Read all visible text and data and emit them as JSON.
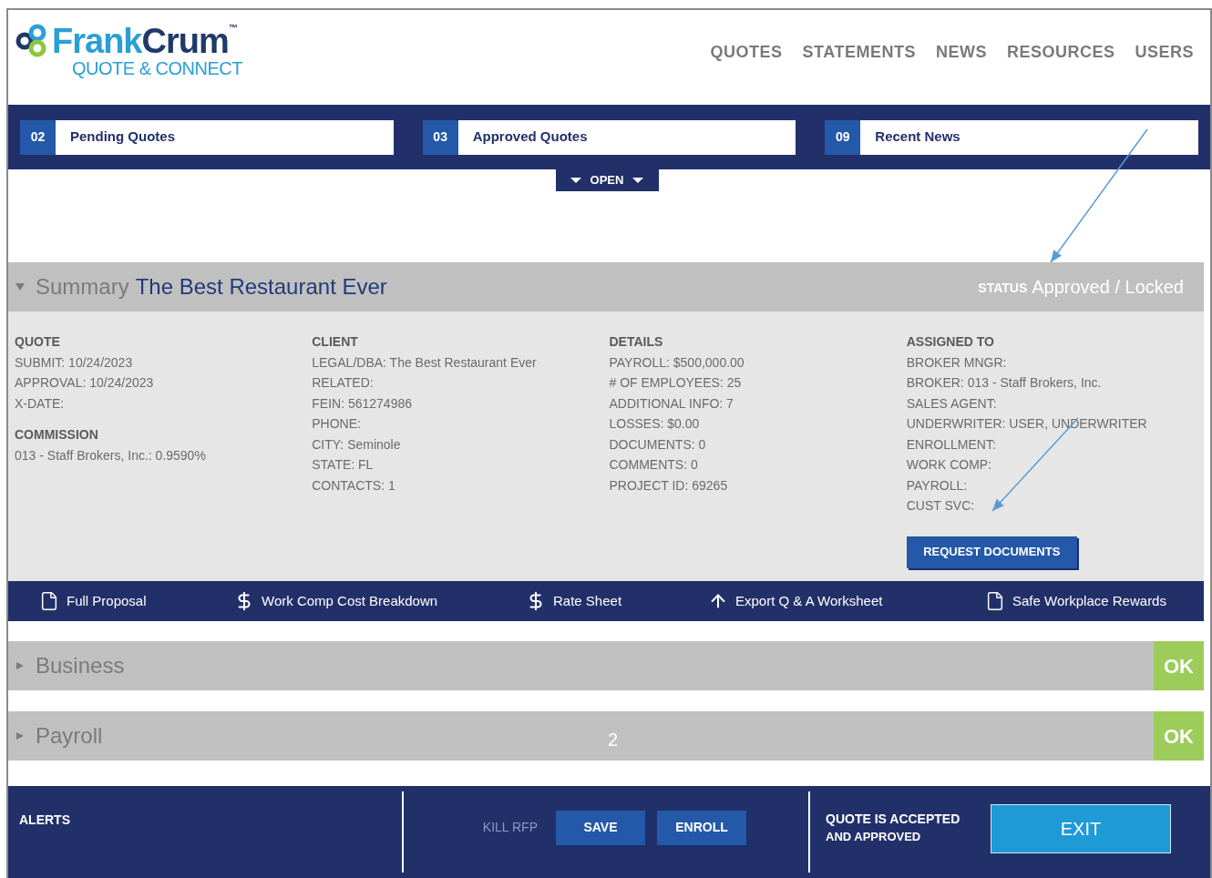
{
  "header": {
    "logo": {
      "brand_first": "Frank",
      "brand_second": "Crum",
      "trademark": "™",
      "tagline": "QUOTE & CONNECT"
    },
    "nav": [
      {
        "label": "QUOTES"
      },
      {
        "label": "STATEMENTS"
      },
      {
        "label": "NEWS"
      },
      {
        "label": "RESOURCES"
      },
      {
        "label": "USERS"
      }
    ]
  },
  "counters": [
    {
      "count": "02",
      "label": "Pending Quotes"
    },
    {
      "count": "03",
      "label": "Approved Quotes"
    },
    {
      "count": "09",
      "label": "Recent News"
    }
  ],
  "toggle": {
    "label": "OPEN"
  },
  "summary": {
    "expanded": true,
    "title": "Summary",
    "client": "The Best Restaurant Ever",
    "status_label": "STATUS",
    "status": "Approved / Locked",
    "columns": [
      {
        "groups": [
          {
            "heading": "QUOTE",
            "lines": [
              "SUBMIT: 10/24/2023",
              "APPROVAL: 10/24/2023",
              "X-DATE:"
            ]
          },
          {
            "heading": "COMMISSION",
            "lines": [
              "013 - Staff Brokers, Inc.: 0.9590%"
            ]
          }
        ]
      },
      {
        "groups": [
          {
            "heading": "CLIENT",
            "lines": [
              "LEGAL/DBA: The Best Restaurant Ever",
              "RELATED:",
              "FEIN: 561274986",
              "PHONE:",
              "CITY: Seminole",
              "STATE: FL",
              "CONTACTS: 1"
            ]
          }
        ]
      },
      {
        "groups": [
          {
            "heading": "DETAILS",
            "lines": [
              "PAYROLL: $500,000.00",
              "# OF EMPLOYEES: 25",
              "ADDITIONAL INFO: 7",
              "LOSSES: $0.00",
              "DOCUMENTS: 0",
              "COMMENTS: 0",
              "PROJECT ID: 69265"
            ]
          }
        ]
      },
      {
        "groups": [
          {
            "heading": "ASSIGNED TO",
            "lines": [
              "BROKER MNGR:",
              "BROKER: 013 - Staff Brokers, Inc.",
              "SALES AGENT:",
              "UNDERWRITER: USER, UNDERWRITER",
              "ENROLLMENT:",
              "WORK COMP:",
              "PAYROLL:",
              "CUST SVC:"
            ]
          }
        ],
        "button": "REQUEST DOCUMENTS"
      }
    ]
  },
  "links": [
    {
      "kind": "document",
      "label": "Full Proposal"
    },
    {
      "kind": "cost",
      "label": "Work Comp Cost Breakdown"
    },
    {
      "kind": "cost",
      "label": "Rate Sheet"
    },
    {
      "kind": "export",
      "label": "Export Q & A Worksheet"
    },
    {
      "kind": "document",
      "label": "Safe Workplace Rewards"
    }
  ],
  "sections": [
    {
      "title": "Business",
      "expanded": false,
      "badge": "OK"
    },
    {
      "title": "Payroll",
      "expanded": false,
      "badge": "OK"
    }
  ],
  "footer": {
    "alerts": "ALERTS",
    "actions": [
      {
        "kind": "link",
        "label": "KILL RFP"
      },
      {
        "kind": "button",
        "label": "SAVE"
      },
      {
        "kind": "button",
        "label": "ENROLL"
      }
    ],
    "message": [
      "QUOTE IS ACCEPTED",
      "AND APPROVED"
    ],
    "exit": "EXIT"
  },
  "annotations": [
    {
      "kind": "arrow"
    },
    {
      "kind": "arrow"
    },
    {
      "kind": "number",
      "text": "2"
    }
  ]
}
